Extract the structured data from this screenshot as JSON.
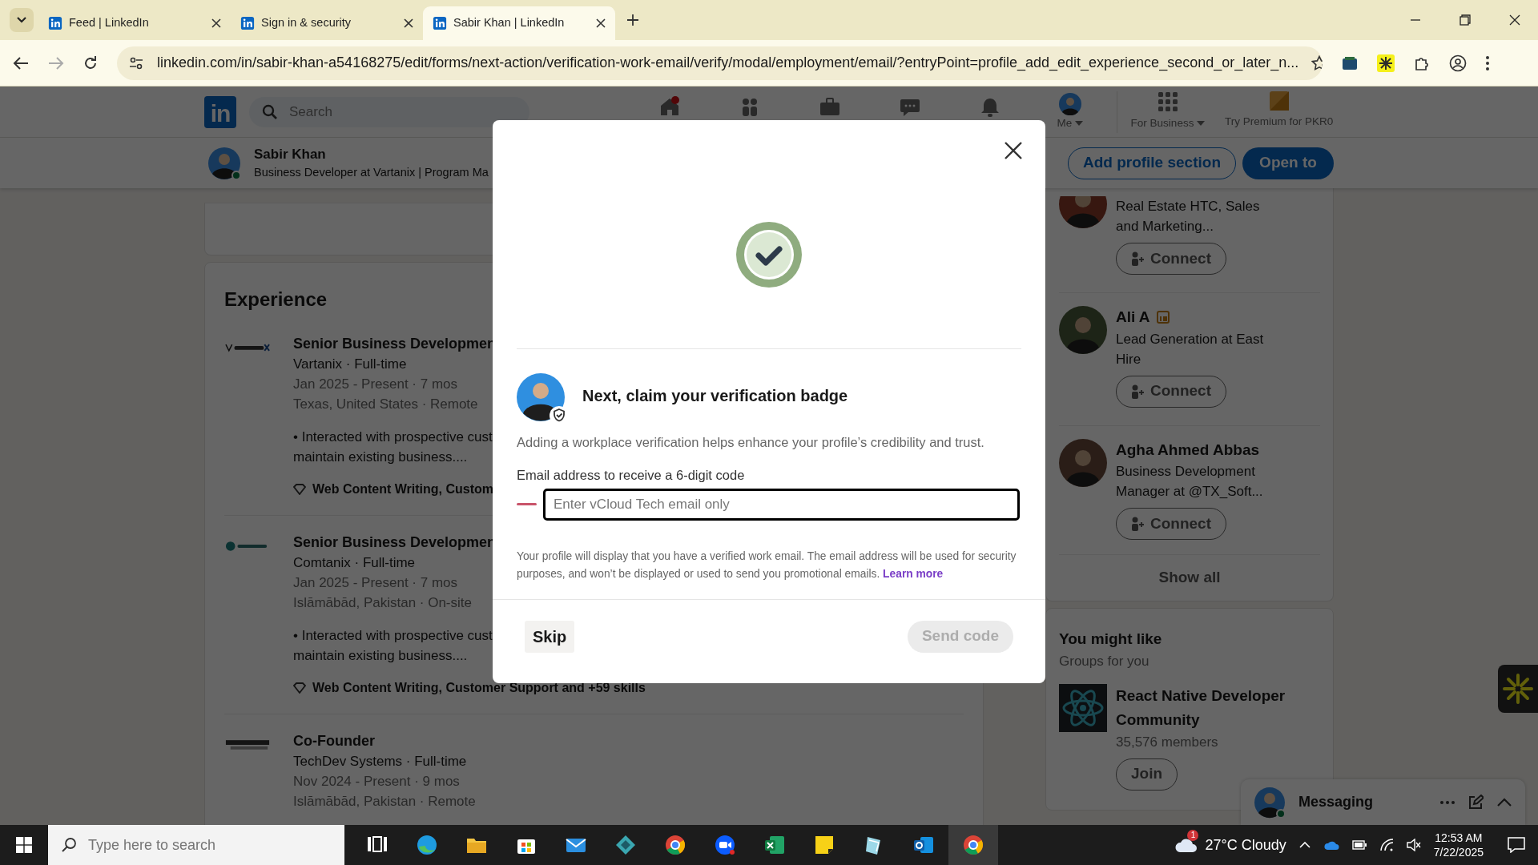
{
  "browser": {
    "tabs": [
      {
        "title": "Feed | LinkedIn",
        "selected": false
      },
      {
        "title": "Sign in & security",
        "selected": false
      },
      {
        "title": "Sabir Khan | LinkedIn",
        "selected": true
      }
    ],
    "url": "linkedin.com/in/sabir-khan-a54168275/edit/forms/next-action/verification-work-email/verify/modal/employment/email/?entryPoint=profile_add_edit_experience_second_or_later_n..."
  },
  "nav": {
    "logo_text": "in",
    "search_placeholder": "Search",
    "me_label": "Me",
    "business_label": "For Business",
    "premium_label": "Try Premium for PKR0"
  },
  "profile_bar": {
    "name": "Sabir Khan",
    "headline": "Business Developer at Vartanix | Program Ma",
    "buttons": [
      {
        "label": "Add profile section",
        "kind": "outline"
      },
      {
        "label": "Open to",
        "kind": "primary"
      }
    ]
  },
  "experience": {
    "title": "Experience",
    "items": [
      {
        "title": "Senior Business Developmen",
        "company": "Vartanix · Full-time",
        "dates": "Jan 2025 - Present · 7 mos",
        "location": "Texas, United States · Remote",
        "description_lines": [
          "• Interacted with prospective cust",
          "maintain existing business...."
        ],
        "skills": "Web Content Writing, Custom"
      },
      {
        "title": "Senior Business Developmen",
        "company": "Comtanix · Full-time",
        "dates": "Jan 2025 - Present · 7 mos",
        "location": "Islāmābād, Pakistan · On-site",
        "description_lines": [
          "• Interacted with prospective cust",
          "maintain existing business...."
        ],
        "skills": "Web Content Writing, Customer Support and +59 skills"
      },
      {
        "title": "Co-Founder",
        "company": "TechDev Systems · Full-time",
        "dates": "Nov 2024 - Present · 9 mos",
        "location": "Islāmābād, Pakistan · Remote"
      }
    ]
  },
  "sidebar": {
    "people": [
      {
        "headline": "Real Estate HTC, Sales and Marketing...",
        "button": "Connect"
      },
      {
        "name": "Ali A",
        "premium": true,
        "headline": "Lead Generation at East Hire",
        "button": "Connect"
      },
      {
        "name": "Agha Ahmed Abbas",
        "premium": false,
        "headline": "Business Development Manager at @TX_Soft...",
        "button": "Connect"
      }
    ],
    "show_all": "Show all",
    "groups_card": {
      "title": "You might like",
      "subtitle": "Groups for you",
      "groups": [
        {
          "name": "React Native Developer Community",
          "members": "35,576 members",
          "button": "Join"
        }
      ]
    }
  },
  "messaging": {
    "title": "Messaging"
  },
  "modal": {
    "heading": "Next, claim your verification badge",
    "intro": "Adding a workplace verification helps enhance your profile’s credibility and trust.",
    "email_label": "Email address to receive a 6-digit code",
    "email_placeholder": "Enter vCloud Tech email only",
    "disclaimer": "Your profile will display that you have a verified work email. The email address will be used for security purposes, and won’t be displayed or used to send you promotional emails.",
    "learn_more": "Learn more",
    "skip": "Skip",
    "send_code": {
      "label": "Send code",
      "disabled": true
    }
  },
  "taskbar": {
    "search_placeholder": "Type here to search",
    "weather": "27°C Cloudy",
    "weather_badge": "1",
    "time": "12:53 AM",
    "date": "7/22/2025",
    "apps": [
      {
        "kind": "taskview",
        "selected": false
      },
      {
        "kind": "edge",
        "selected": false
      },
      {
        "kind": "folder",
        "selected": false
      },
      {
        "kind": "store",
        "selected": false
      },
      {
        "kind": "mail",
        "selected": false
      },
      {
        "kind": "diamond",
        "selected": false
      },
      {
        "kind": "chrome",
        "selected": false
      },
      {
        "kind": "zoom",
        "selected": false
      },
      {
        "kind": "sheet",
        "selected": false
      },
      {
        "kind": "note",
        "selected": false
      },
      {
        "kind": "glass",
        "selected": false
      },
      {
        "kind": "outlook",
        "selected": false
      },
      {
        "kind": "chrome",
        "selected": true
      }
    ]
  }
}
